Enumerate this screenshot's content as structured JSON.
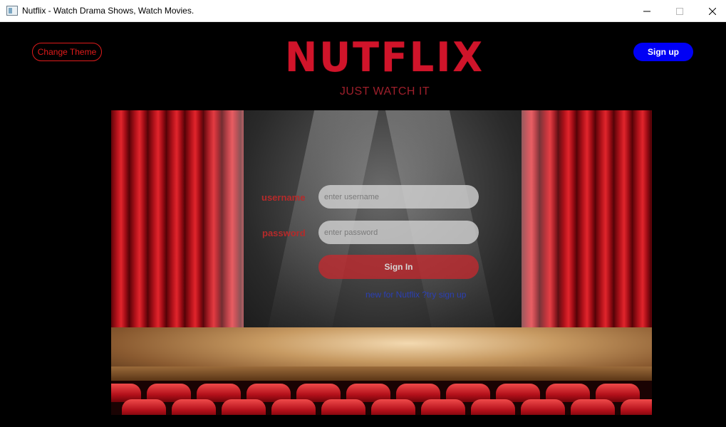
{
  "window": {
    "title": "Nutflix - Watch Drama Shows, Watch Movies."
  },
  "header": {
    "change_theme_label": "Change Theme",
    "logo_text": "NUTFLIX",
    "tagline": "JUST WATCH IT",
    "signup_label": "Sign up"
  },
  "login": {
    "username_label": "username",
    "username_placeholder": "enter username",
    "password_label": "password",
    "password_placeholder": "enter password",
    "signin_label": "Sign In",
    "signup_link_text": "new  for Nutflix ?try sign up"
  },
  "colors": {
    "accent_red": "#e01b1b",
    "signup_blue": "#0000f5",
    "link_blue": "#2b3fb4"
  }
}
